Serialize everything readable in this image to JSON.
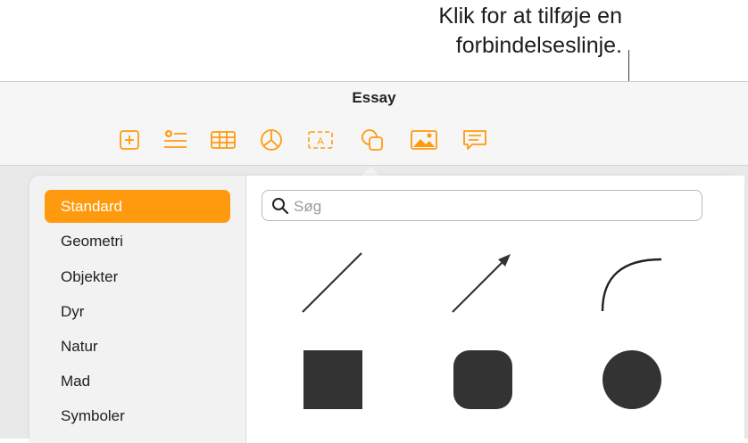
{
  "callout": {
    "line1": "Klik for at tilføje en",
    "line2": "forbindelseslinje."
  },
  "window": {
    "title": "Essay",
    "toolbar_icons": [
      "add-page-icon",
      "insert-list-icon",
      "table-icon",
      "chart-icon",
      "text-box-icon",
      "shape-icon",
      "media-icon",
      "comment-icon"
    ],
    "accent_color": "#ff9a0e"
  },
  "shapes_popover": {
    "categories": [
      "Standard",
      "Geometri",
      "Objekter",
      "Dyr",
      "Natur",
      "Mad",
      "Symboler"
    ],
    "selected_category": "Standard",
    "search_placeholder": "Søg",
    "shapes": [
      "line",
      "arrow-line",
      "curved-connection-line",
      "square",
      "rounded-square",
      "circle"
    ],
    "shape_color": "#333333"
  }
}
